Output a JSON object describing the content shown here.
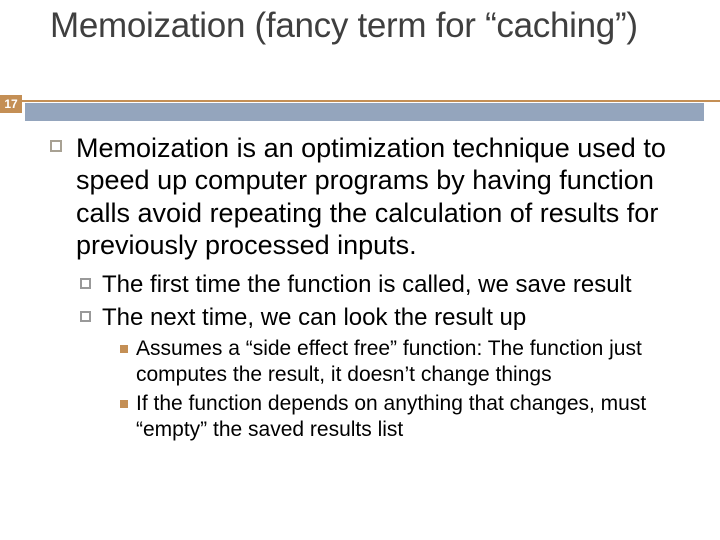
{
  "slide_number": "17",
  "title": "Memoization (fancy term for “caching”)",
  "accent_color": "#c48f55",
  "bar_color": "#94a5bd",
  "body": {
    "lvl1": "Memoization is an optimization technique used to speed up computer programs by having function calls avoid repeating the calculation of results for previously processed inputs.",
    "lvl2a": "The first time the function is called, we save result",
    "lvl2b": "The next time, we can look the result up",
    "lvl3a": "Assumes a “side effect free” function: The function just computes the result, it doesn’t change things",
    "lvl3b": "If the function depends on anything that changes, must “empty” the saved results list"
  }
}
